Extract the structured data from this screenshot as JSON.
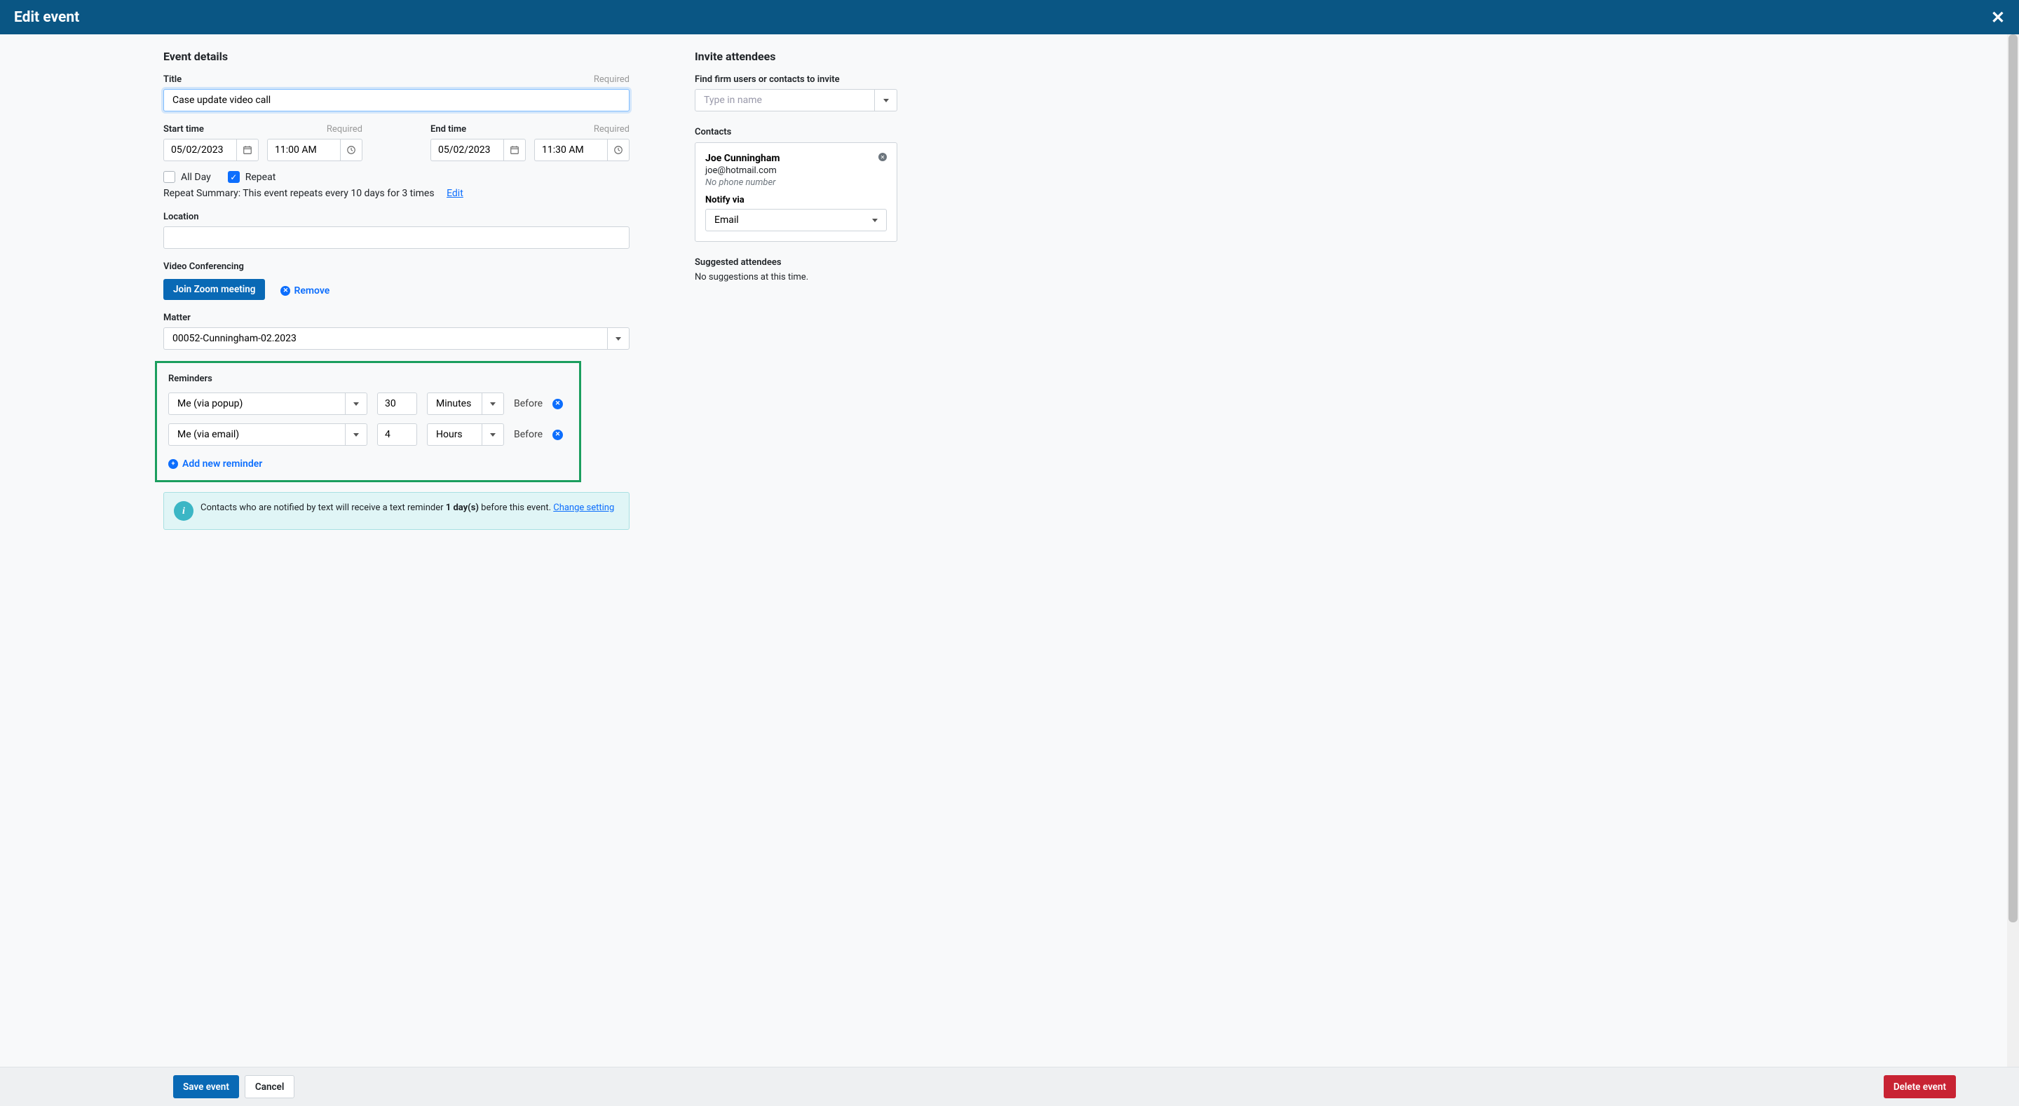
{
  "header": {
    "title": "Edit event"
  },
  "event_details": {
    "section_title": "Event details",
    "title_label": "Title",
    "title_required": "Required",
    "title_value": "Case update video call",
    "start_label": "Start time",
    "start_required": "Required",
    "start_date": "05/02/2023",
    "start_time": "11:00 AM",
    "end_label": "End time",
    "end_required": "Required",
    "end_date": "05/02/2023",
    "end_time": "11:30 AM",
    "all_day_label": "All Day",
    "all_day_checked": false,
    "repeat_label": "Repeat",
    "repeat_checked": true,
    "repeat_summary": "Repeat Summary: This event repeats every 10 days for 3 times",
    "repeat_edit_link": "Edit",
    "location_label": "Location",
    "location_value": "",
    "video_conf_label": "Video Conferencing",
    "join_zoom_label": "Join Zoom meeting",
    "remove_label": "Remove",
    "matter_label": "Matter",
    "matter_value": "00052-Cunningham-02.2023"
  },
  "reminders": {
    "section_title": "Reminders",
    "rows": [
      {
        "who": "Me (via popup)",
        "amount": "30",
        "unit": "Minutes",
        "before": "Before"
      },
      {
        "who": "Me (via email)",
        "amount": "4",
        "unit": "Hours",
        "before": "Before"
      }
    ],
    "add_label": "Add new reminder"
  },
  "info": {
    "text_before": "Contacts who are notified by text will receive a text reminder ",
    "bold_text": "1 day(s)",
    "text_after": " before this event. ",
    "link_text": "Change setting"
  },
  "attendees": {
    "section_title": "Invite attendees",
    "find_label": "Find firm users or contacts to invite",
    "find_placeholder": "Type in name",
    "contacts_label": "Contacts",
    "contact": {
      "name": "Joe Cunningham",
      "email": "joe@hotmail.com",
      "phone": "No phone number",
      "notify_label": "Notify via",
      "notify_value": "Email"
    },
    "suggested_label": "Suggested attendees",
    "suggested_text": "No suggestions at this time."
  },
  "footer": {
    "save": "Save event",
    "cancel": "Cancel",
    "delete": "Delete event"
  }
}
